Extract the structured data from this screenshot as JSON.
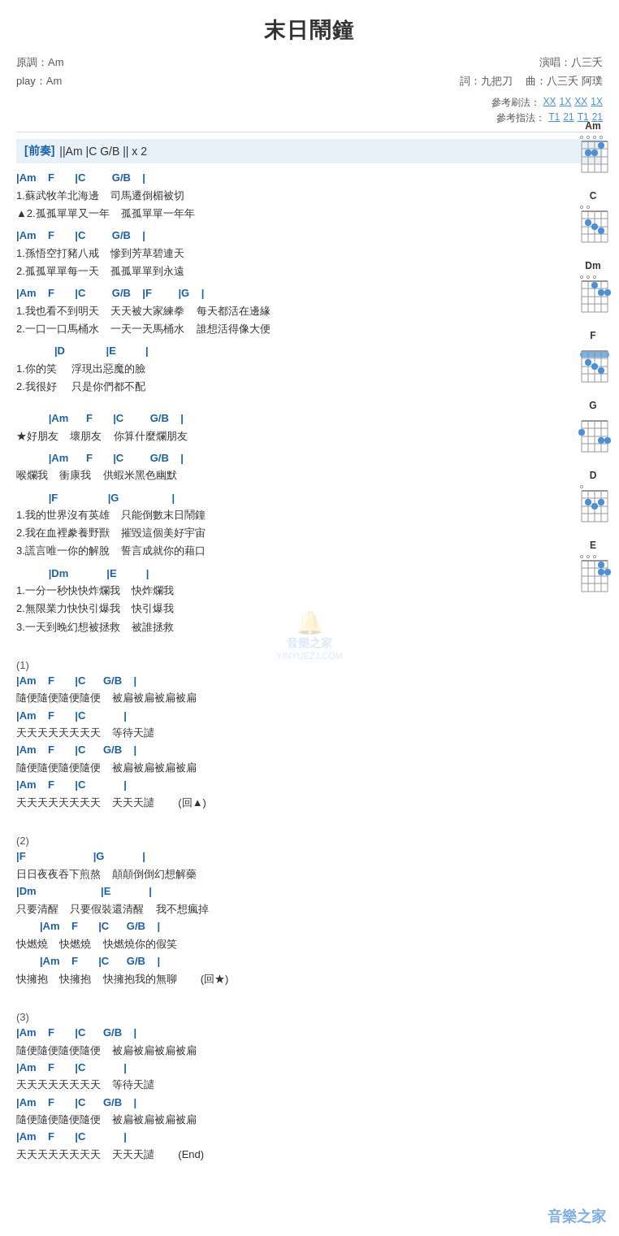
{
  "title": "末日鬧鐘",
  "meta": {
    "key": "原調：Am",
    "play": "play：Am",
    "singer": "演唱：八三夭",
    "lyricist": "詞：九把刀",
    "composer": "曲：八三夭 阿璞"
  },
  "refs": {
    "strum": "參考刷法：",
    "strum_links": [
      "XX",
      "1X",
      "XX",
      "1X"
    ],
    "fingering": "參考指法：",
    "fingering_links": [
      "T1",
      "21",
      "T1",
      "21"
    ]
  },
  "intro": {
    "label": "[前奏]",
    "content": "||Am  |C   G/B  || x 2"
  },
  "chord_diagrams": [
    {
      "name": "Am",
      "open_strings": "oooo",
      "dots": [
        [
          2,
          2
        ],
        [
          2,
          3
        ],
        [
          1,
          4
        ]
      ],
      "barre": null
    },
    {
      "name": "C",
      "open_strings": "oo",
      "dots": [
        [
          2,
          2
        ],
        [
          3,
          5
        ],
        [
          3,
          4
        ]
      ],
      "barre": null
    },
    {
      "name": "Dm",
      "open_strings": "ooo",
      "dots": [
        [
          2,
          1
        ],
        [
          2,
          3
        ],
        [
          1,
          2
        ]
      ],
      "barre": null
    },
    {
      "name": "F",
      "open_strings": "",
      "dots": [
        [
          1,
          1
        ],
        [
          1,
          2
        ],
        [
          2,
          3
        ],
        [
          3,
          4
        ]
      ],
      "barre": 1
    },
    {
      "name": "G",
      "open_strings": "",
      "dots": [
        [
          2,
          1
        ],
        [
          3,
          5
        ],
        [
          3,
          6
        ]
      ],
      "barre": null
    },
    {
      "name": "D",
      "open_strings": "o",
      "dots": [
        [
          2,
          1
        ],
        [
          2,
          3
        ],
        [
          3,
          2
        ]
      ],
      "barre": null
    },
    {
      "name": "E",
      "open_strings": "ooo",
      "dots": [
        [
          1,
          3
        ],
        [
          2,
          4
        ],
        [
          2,
          5
        ]
      ],
      "barre": null
    }
  ],
  "sections": [
    {
      "id": "s1",
      "chords": "|Am    F       |C         G/B    |",
      "lyrics": [
        "1.蘇武牧羊北海邊    司馬遷倒楣被切",
        "▲2.孤孤單單又一年    孤孤單單一年年"
      ]
    },
    {
      "id": "s2",
      "chords": "|Am    F       |C         G/B    |",
      "lyrics": [
        "1.孫悟空打豬八戒    慘到芳草碧連天",
        "2.孤孤單單每一天    孤孤單單到永遠"
      ]
    },
    {
      "id": "s3",
      "chords": "|Am    F       |C         G/B    |F         |G    |",
      "lyrics": [
        "1.我也看不到明天    天天被大家練拳    每天都活在邊緣",
        "2.一口一口馬桶水    一天一天馬桶水    誰想活得像大便"
      ]
    },
    {
      "id": "s4",
      "chords": "         |D              |E          |",
      "lyrics": [
        "1.你的笑     浮現出惡魔的臉",
        "2.我很好     只是你們都不配"
      ]
    },
    {
      "id": "s5",
      "chords": "        |Am      F       |C         G/B    |",
      "lyrics": [
        "★好朋友    壞朋友    你算什麼爛朋友"
      ]
    },
    {
      "id": "s6",
      "chords": "        |Am      F       |C         G/B    |",
      "lyrics": [
        "喉爛我    衝康我    供蝦米黑色幽默"
      ]
    },
    {
      "id": "s7",
      "chords": "        |F                 |G                  |",
      "lyrics": [
        "1.我的世界沒有英雄    只能倒數末日鬧鐘",
        "2.我在血裡豢養野獸    摧毀這個美好宇宙",
        "3.謊言唯一你的解脫    誓言成就你的藉口"
      ]
    },
    {
      "id": "s8",
      "chords": "        |Dm             |E          |",
      "lyrics": [
        "1.一分一秒快快炸爛我    快炸爛我",
        "2.無限業力快快引爆我    快引爆我",
        "3.一天到晚幻想被拯救    被誰拯救"
      ]
    },
    {
      "id": "p1",
      "label": "(1)",
      "lines": [
        {
          "chord": "|Am    F       |C      G/B    |",
          "lyric": "隨便隨便隨便隨便    被扁被扁被扁被扁"
        },
        {
          "chord": "|Am    F       |C             |",
          "lyric": "天天天天天天天天    等待天譴"
        },
        {
          "chord": "|Am    F       |C      G/B    |",
          "lyric": "隨便隨便隨便隨便    被扁被扁被扁被扁"
        },
        {
          "chord": "|Am    F       |C             |",
          "lyric": "天天天天天天天天    天天天譴        (回▲)"
        }
      ]
    },
    {
      "id": "p2",
      "label": "(2)",
      "lines": [
        {
          "chord": "|F                       |G             |",
          "lyric": "日日夜夜吞下煎熬    顛顛倒倒幻想解藥"
        },
        {
          "chord": "|Dm                      |E             |",
          "lyric": "只要清醒    只要假裝還清醒    我不想瘋掉"
        },
        {
          "chord": "        |Am    F       |C      G/B    |",
          "lyric": "快燃燒    快燃燒    快燃燒你的假笑"
        },
        {
          "chord": "        |Am    F       |C      G/B    |",
          "lyric": "快擁抱    快擁抱    快擁抱我的無聊        (回★)"
        }
      ]
    },
    {
      "id": "p3",
      "label": "(3)",
      "lines": [
        {
          "chord": "|Am    F       |C      G/B    |",
          "lyric": "隨便隨便隨便隨便    被扁被扁被扁被扁"
        },
        {
          "chord": "|Am    F       |C             |",
          "lyric": "天天天天天天天天    等待天譴"
        },
        {
          "chord": "|Am    F       |C      G/B    |",
          "lyric": "隨便隨便隨便隨便    被扁被扁被扁被扁"
        },
        {
          "chord": "|Am    F       |C             |",
          "lyric": "天天天天天天天天    天天天譴        (End)"
        }
      ]
    }
  ],
  "watermark": {
    "icon": "🔔",
    "site": "音樂之家",
    "url": "YINYUEZJ.COM"
  },
  "bottom_logo": "音樂之家"
}
